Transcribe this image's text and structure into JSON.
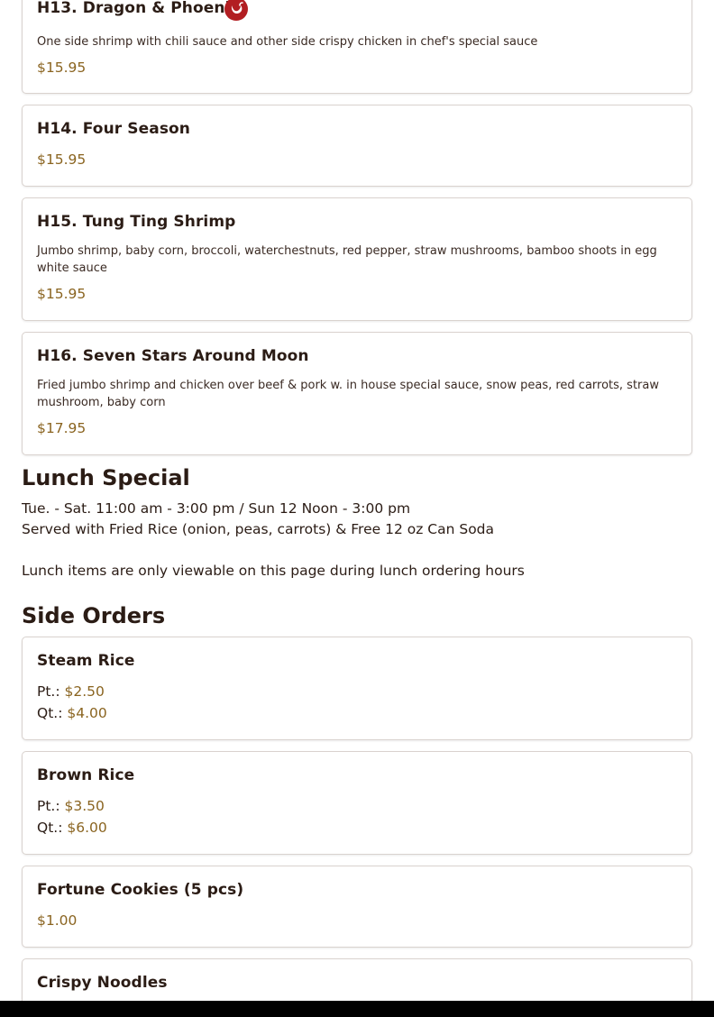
{
  "items_top": [
    {
      "name": "H13. Dragon & Phoenix",
      "spicy": true,
      "description": "One side shrimp with chili sauce and other side crispy chicken in chef's special sauce",
      "price": "$15.95"
    },
    {
      "name": "H14. Four Season",
      "price": "$15.95"
    },
    {
      "name": "H15. Tung Ting Shrimp",
      "description": "Jumbo shrimp, baby corn, broccoli, waterchestnuts, red pepper, straw mushrooms, bamboo shoots in egg white sauce",
      "price": "$15.95"
    },
    {
      "name": "H16. Seven Stars Around Moon",
      "description": "Fried jumbo shrimp and chicken over beef & pork w. in house special sauce, snow peas, red carrots, straw mushroom, baby corn",
      "price": "$17.95"
    }
  ],
  "lunch_special": {
    "title": "Lunch Special",
    "hours": "Tue. - Sat. 11:00 am - 3:00 pm / Sun 12 Noon - 3:00 pm",
    "served_with": "Served with Fried Rice (onion, peas, carrots) & Free 12 oz Can Soda",
    "notice": "Lunch items are only viewable on this page during lunch ordering hours"
  },
  "side_orders": {
    "title": "Side Orders",
    "items": [
      {
        "name": "Steam Rice",
        "sizes": [
          {
            "label": "Pt.:",
            "price": "$2.50"
          },
          {
            "label": "Qt.:",
            "price": "$4.00"
          }
        ]
      },
      {
        "name": "Brown Rice",
        "sizes": [
          {
            "label": "Pt.:",
            "price": "$3.50"
          },
          {
            "label": "Qt.:",
            "price": "$6.00"
          }
        ]
      },
      {
        "name": "Fortune Cookies (5 pcs)",
        "price": "$1.00"
      },
      {
        "name": "Crispy Noodles"
      }
    ]
  },
  "icons": {
    "spicy": "chili-pepper-icon"
  },
  "colors": {
    "price": "#8a6420",
    "text": "#2b1c15",
    "spicy_badge": "#b21e22",
    "border": "#d9d2ce"
  }
}
